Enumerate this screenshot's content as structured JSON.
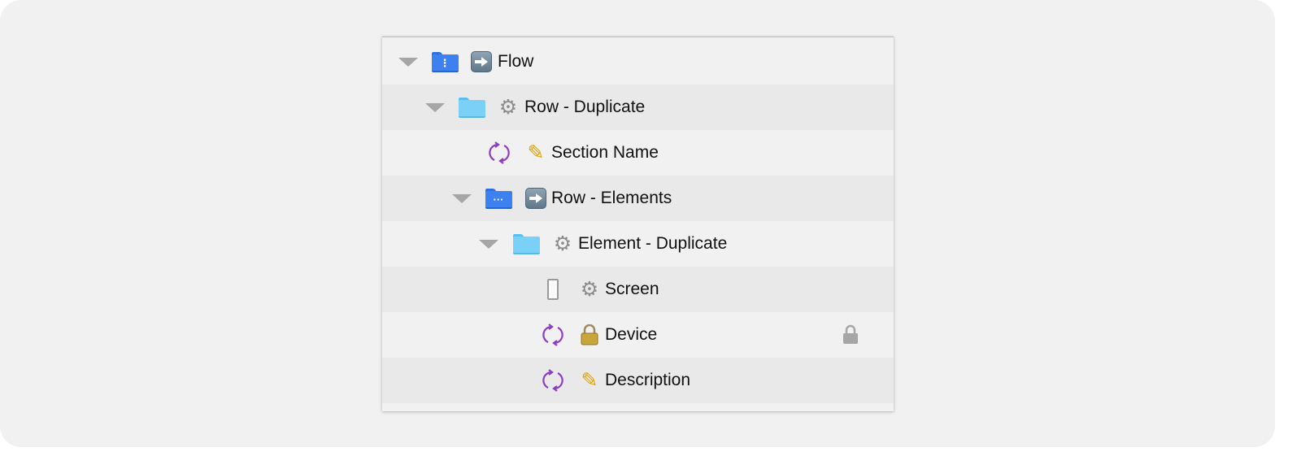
{
  "tree": {
    "rows": [
      {
        "label": "Flow"
      },
      {
        "label": "Row - Duplicate"
      },
      {
        "label": "Section Name"
      },
      {
        "label": "Row - Elements"
      },
      {
        "label": "Element - Duplicate"
      },
      {
        "label": "Screen"
      },
      {
        "label": "Device"
      },
      {
        "label": "Description"
      }
    ]
  },
  "icons": {
    "disclosure": "disclosure-triangle-icon",
    "folder_blue": "blue-folder-icon",
    "folder_light": "light-blue-folder-icon",
    "arrow": "right-arrow-icon",
    "gear": "gear-icon",
    "pencil": "pencil-icon",
    "lock": "lock-icon",
    "sync": "sync-icon",
    "phone": "phone-outline-icon"
  },
  "colors": {
    "backdrop": "#f1f1f1",
    "row_alt": "#e9e9e9",
    "folder_blue": "#3d80f0",
    "folder_light": "#7bd0f7",
    "sync_purple": "#8e3cc0",
    "triangle_gray": "#a6a6a6"
  }
}
